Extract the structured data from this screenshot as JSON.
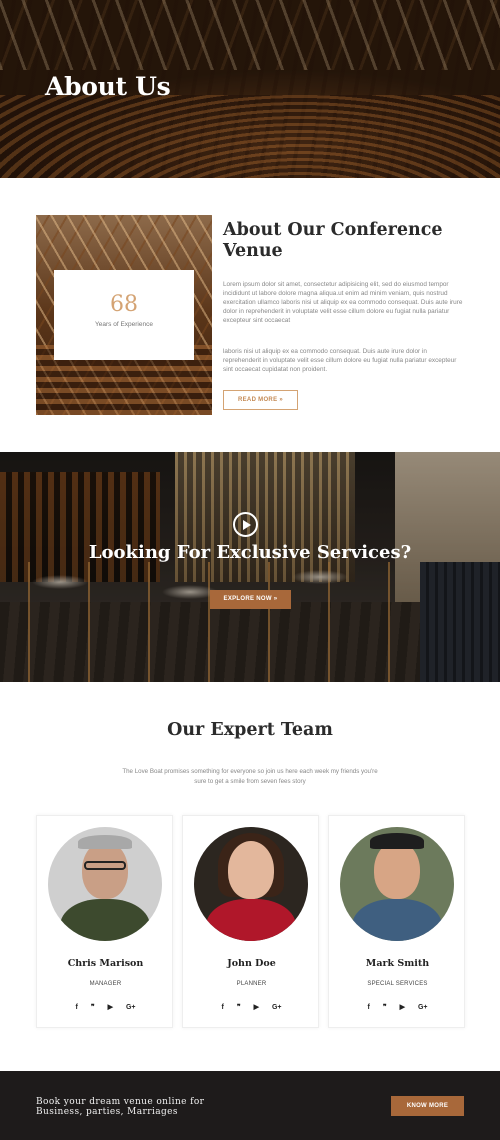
{
  "hero": {
    "title": "About Us"
  },
  "about": {
    "experience_number": "68",
    "experience_label": "Years of Experience",
    "title": "About Our Conference Venue",
    "paragraph1": "Lorem ipsum dolor sit amet, consectetur adipisicing elit, sed do eiusmod tempor incididunt ut labore dolore magna aliqua.ut enim ad minim veniam, quis nostrud exercitation ullamco laboris nisi ut aliquip ex ea commodo consequat. Duis aute irure dolor in reprehenderit in voluptate velit esse cillum dolore eu fugiat nulla pariatur excepteur sint occaecat",
    "paragraph2": "laboris nisi ut aliquip ex ea commodo consequat. Duis aute irure dolor in reprehenderit in voluptate velit esse cillum dolore eu fugiat nulla pariatur excepteur sint occaecat cupidatat non proident.",
    "read_more_label": "READ MORE »"
  },
  "services": {
    "title": "Looking For Exclusive Services?",
    "explore_label": "EXPLORE NOW »"
  },
  "team": {
    "title": "Our Expert Team",
    "subtitle": "The Love Boat promises something for everyone so join us here each week my friends you're sure to get a smile from seven fees story",
    "members": [
      {
        "name": "Chris Marison",
        "role": "MANAGER"
      },
      {
        "name": "John Doe",
        "role": "PLANNER"
      },
      {
        "name": "Mark Smith",
        "role": "SPECIAL SERVICES"
      }
    ],
    "social_icons": [
      {
        "icon": "facebook-icon",
        "glyph": "f"
      },
      {
        "icon": "twitter-icon",
        "glyph": "❞"
      },
      {
        "icon": "youtube-icon",
        "glyph": "▶"
      },
      {
        "icon": "google-plus-icon",
        "glyph": "G+"
      }
    ]
  },
  "cta": {
    "line1": "Book your dream venue online for",
    "line2": "Business, parties, Marriages",
    "button_label": "KNOW MORE"
  },
  "colors": {
    "accent": "#a8683a",
    "accent_light": "#d4a373",
    "dark_footer": "#1e1b1b"
  }
}
